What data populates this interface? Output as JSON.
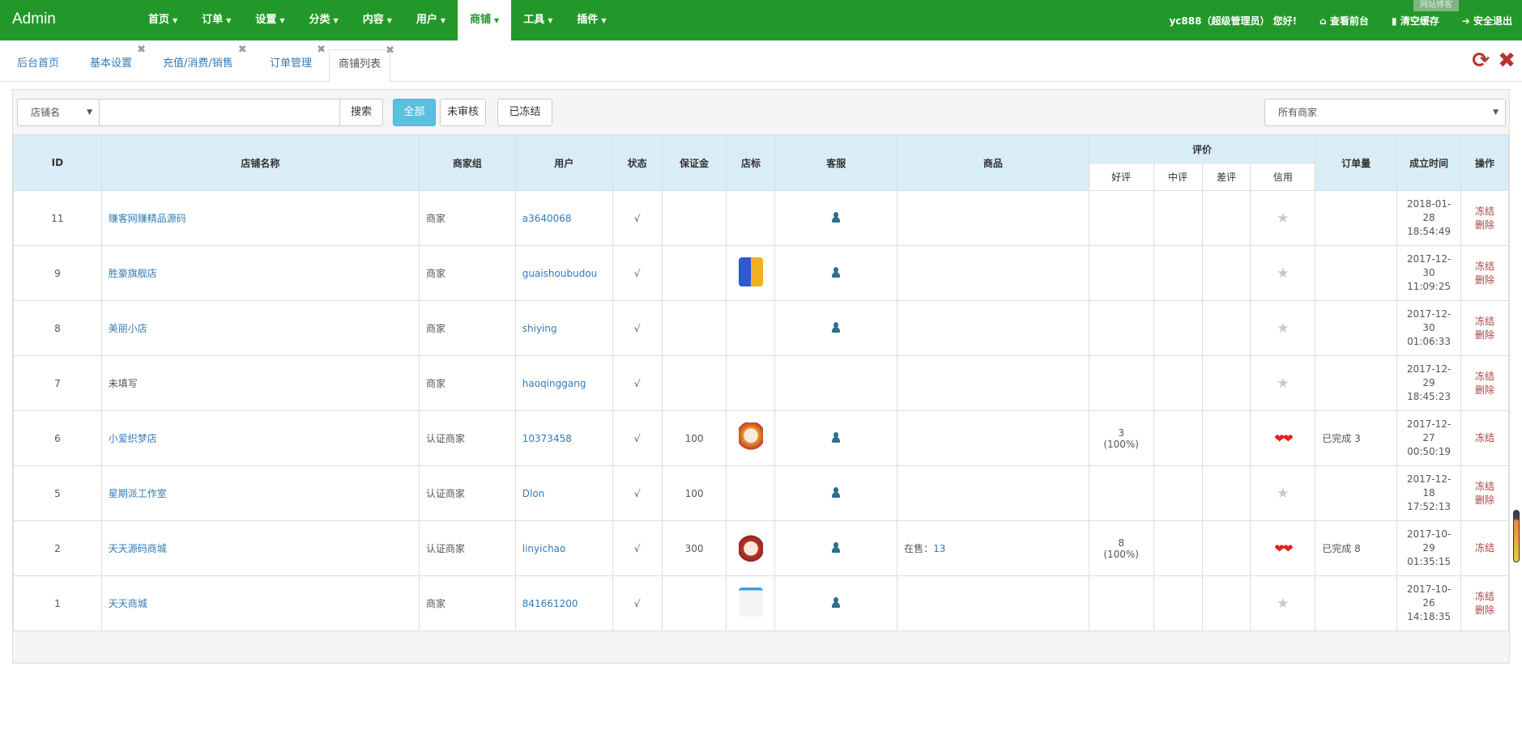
{
  "nav": {
    "brand": "Admin",
    "menu": [
      {
        "label": "首页"
      },
      {
        "label": "订单"
      },
      {
        "label": "设置"
      },
      {
        "label": "分类"
      },
      {
        "label": "内容"
      },
      {
        "label": "用户"
      },
      {
        "label": "商铺",
        "active": true
      },
      {
        "label": "工具"
      },
      {
        "label": "插件"
      }
    ],
    "greeting": "yc888（超级管理员） 您好!",
    "view_front": "查看前台",
    "clear_cache": "清空缓存",
    "logout": "安全退出",
    "tooltip": "网站博客"
  },
  "tabs": [
    {
      "label": "后台首页",
      "closable": false
    },
    {
      "label": "基本设置",
      "closable": true
    },
    {
      "label": "充值/消费/销售",
      "closable": true
    },
    {
      "label": "订单管理",
      "closable": true
    },
    {
      "label": "商铺列表",
      "closable": true,
      "active": true
    }
  ],
  "toolbar": {
    "field_select": "店铺名",
    "search_value": "",
    "search_button": "搜索",
    "filter_all": "全部",
    "filter_pending": "未审核",
    "filter_frozen": "已冻结",
    "merchant_select": "所有商家"
  },
  "table": {
    "headers": {
      "id": "ID",
      "name": "店铺名称",
      "group": "商家组",
      "user": "用户",
      "status": "状态",
      "deposit": "保证金",
      "logo": "店标",
      "service": "客服",
      "goods": "商品",
      "rating": "评价",
      "good": "好评",
      "mid": "中评",
      "bad": "差评",
      "credit": "信用",
      "orders": "订单量",
      "created": "成立时间",
      "ops": "操作"
    },
    "rows": [
      {
        "id": "11",
        "name": "赚客网赚精品源码",
        "name_link": true,
        "group": "商家",
        "user": "a3640068",
        "status": "√",
        "deposit": "",
        "logo": "",
        "service": true,
        "goods_label": "",
        "goods_count": "",
        "good": "",
        "good_pct": "",
        "credit": "star",
        "orders": "",
        "date": "2018-01-",
        "day": "28",
        "time": "18:54:49",
        "ops": [
          "冻结",
          "删除"
        ]
      },
      {
        "id": "9",
        "name": "胜豪旗舰店",
        "name_link": true,
        "group": "商家",
        "user": "guaishoubudou",
        "status": "√",
        "deposit": "",
        "logo": "shield",
        "service": true,
        "goods_label": "",
        "goods_count": "",
        "good": "",
        "good_pct": "",
        "credit": "star",
        "orders": "",
        "date": "2017-12-",
        "day": "30",
        "time": "11:09:25",
        "ops": [
          "冻结",
          "删除"
        ]
      },
      {
        "id": "8",
        "name": "美丽小店",
        "name_link": true,
        "group": "商家",
        "user": "shiying",
        "status": "√",
        "deposit": "",
        "logo": "",
        "service": true,
        "goods_label": "",
        "goods_count": "",
        "good": "",
        "good_pct": "",
        "credit": "star",
        "orders": "",
        "date": "2017-12-",
        "day": "30",
        "time": "01:06:33",
        "ops": [
          "冻结",
          "删除"
        ]
      },
      {
        "id": "7",
        "name": "未填写",
        "name_link": false,
        "group": "商家",
        "user": "haoqinggang",
        "status": "√",
        "deposit": "",
        "logo": "",
        "service": false,
        "goods_label": "",
        "goods_count": "",
        "good": "",
        "good_pct": "",
        "credit": "star",
        "orders": "",
        "date": "2017-12-",
        "day": "29",
        "time": "18:45:23",
        "ops": [
          "冻结",
          "删除"
        ]
      },
      {
        "id": "6",
        "name": "小爱织梦店",
        "name_link": true,
        "group": "认证商家",
        "user": "10373458",
        "status": "√",
        "deposit": "100",
        "logo": "avatar-girl",
        "service": true,
        "goods_label": "",
        "goods_count": "",
        "good": "3",
        "good_pct": "(100%)",
        "credit": "hearts",
        "orders": "已完成 3",
        "date": "2017-12-",
        "day": "27",
        "time": "00:50:19",
        "ops": [
          "冻结"
        ]
      },
      {
        "id": "5",
        "name": "星期派工作室",
        "name_link": true,
        "group": "认证商家",
        "user": "Dlon",
        "status": "√",
        "deposit": "100",
        "logo": "",
        "service": true,
        "goods_label": "",
        "goods_count": "",
        "good": "",
        "good_pct": "",
        "credit": "star",
        "orders": "",
        "date": "2017-12-",
        "day": "18",
        "time": "17:52:13",
        "ops": [
          "冻结",
          "删除"
        ]
      },
      {
        "id": "2",
        "name": "天天源码商城",
        "name_link": true,
        "group": "认证商家",
        "user": "linyichao",
        "status": "√",
        "deposit": "300",
        "logo": "avatar-boy",
        "service": true,
        "goods_label": "在售：",
        "goods_count": "13",
        "good": "8",
        "good_pct": "(100%)",
        "credit": "hearts",
        "orders": "已完成 8",
        "date": "2017-10-",
        "day": "29",
        "time": "01:35:15",
        "ops": [
          "冻结"
        ]
      },
      {
        "id": "1",
        "name": "天天商城",
        "name_link": true,
        "group": "商家",
        "user": "841661200",
        "status": "√",
        "deposit": "",
        "logo": "screenshot",
        "service": true,
        "goods_label": "",
        "goods_count": "",
        "good": "",
        "good_pct": "",
        "credit": "star",
        "orders": "",
        "date": "2017-10-",
        "day": "26",
        "time": "14:18:35",
        "ops": [
          "冻结",
          "删除"
        ]
      }
    ]
  },
  "colors": {
    "nav": "#23982a",
    "link": "#337ab7",
    "danger": "#a94442",
    "header": "#d9edf7",
    "primary": "#5bc0de"
  }
}
